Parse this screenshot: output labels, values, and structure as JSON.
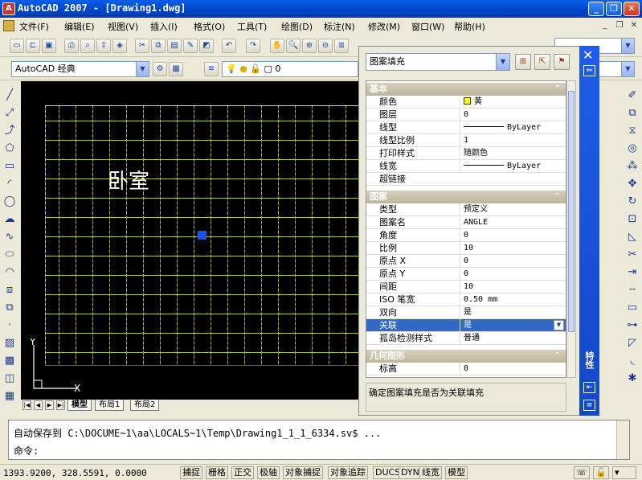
{
  "window": {
    "title": "AutoCAD 2007 - [Drawing1.dwg]",
    "app_icon": "A"
  },
  "menu": [
    "文件(F)",
    "编辑(E)",
    "视图(V)",
    "插入(I)",
    "格式(O)",
    "工具(T)",
    "绘图(D)",
    "标注(N)",
    "修改(M)",
    "窗口(W)",
    "帮助(H)"
  ],
  "workspace": {
    "selected": "AutoCAD 经典"
  },
  "layer": {
    "current": "0"
  },
  "drawing": {
    "room_label": "卧室",
    "ucs_x": "X",
    "ucs_y": "Y"
  },
  "layout_tabs": [
    "模型",
    "布局1",
    "布局2"
  ],
  "properties": {
    "object_type": "图案填充",
    "category_basic": "基本",
    "basic": [
      {
        "key": "颜色",
        "value": "黄",
        "swatch": "#ffff00"
      },
      {
        "key": "图层",
        "value": "0"
      },
      {
        "key": "线型",
        "value": "ByLayer",
        "line": true
      },
      {
        "key": "线型比例",
        "value": "1"
      },
      {
        "key": "打印样式",
        "value": "随颜色"
      },
      {
        "key": "线宽",
        "value": "ByLayer",
        "line": true
      },
      {
        "key": "超链接",
        "value": ""
      }
    ],
    "category_pattern": "图案",
    "pattern": [
      {
        "key": "类型",
        "value": "预定义"
      },
      {
        "key": "图案名",
        "value": "ANGLE"
      },
      {
        "key": "角度",
        "value": "0"
      },
      {
        "key": "比例",
        "value": "10"
      },
      {
        "key": "原点 X",
        "value": "0"
      },
      {
        "key": "原点 Y",
        "value": "0"
      },
      {
        "key": "间距",
        "value": "10"
      },
      {
        "key": "ISO 笔宽",
        "value": "0.50 mm"
      },
      {
        "key": "双向",
        "value": "是"
      },
      {
        "key": "关联",
        "value": "是"
      },
      {
        "key": "孤岛检测样式",
        "value": "普通"
      }
    ],
    "category_geometry": "几何图形",
    "geometry": [
      {
        "key": "标高",
        "value": "0"
      }
    ],
    "description": "确定图案填充是否为关联填充",
    "strip_label": "特性"
  },
  "command": {
    "line1": "自动保存到 C:\\DOCUME~1\\aa\\LOCALS~1\\Temp\\Drawing1_1_1_6334.sv$ ...",
    "prompt": "命令:"
  },
  "status": {
    "coordinates": "1393.9200, 328.5591, 0.0000",
    "buttons": [
      "捕捉",
      "栅格",
      "正交",
      "极轴",
      "对象捕捉",
      "对象追踪",
      "DUCS",
      "DYN",
      "线宽",
      "模型"
    ]
  }
}
